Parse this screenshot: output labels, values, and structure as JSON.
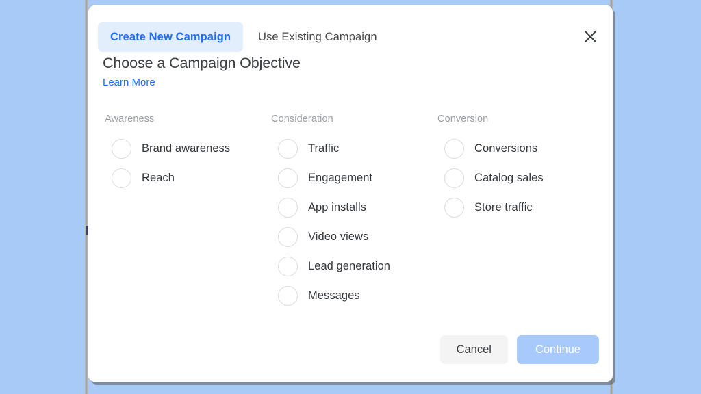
{
  "theme": {
    "backdrop_color": "#a7caf6",
    "modal_bg": "#ffffff",
    "accent_blue": "#1f6ffc",
    "active_tab_bg": "#e3eefd",
    "muted_text": "#9aa0a6",
    "body_text": "#35393d",
    "continue_bg": "#a7c9fb",
    "cancel_bg": "#f4f4f4",
    "radio_border": "#dadce0"
  },
  "modal": {
    "tabs": [
      {
        "label": "Create New Campaign",
        "active": true
      },
      {
        "label": "Use Existing Campaign",
        "active": false
      }
    ],
    "close_icon": "close-icon",
    "heading": "Choose a Campaign Objective",
    "learn_more": "Learn More",
    "columns": [
      {
        "title": "Awareness",
        "options": [
          {
            "label": "Brand awareness",
            "selected": false
          },
          {
            "label": "Reach",
            "selected": false
          }
        ]
      },
      {
        "title": "Consideration",
        "options": [
          {
            "label": "Traffic",
            "selected": false
          },
          {
            "label": "Engagement",
            "selected": false
          },
          {
            "label": "App installs",
            "selected": false
          },
          {
            "label": "Video views",
            "selected": false
          },
          {
            "label": "Lead generation",
            "selected": false
          },
          {
            "label": "Messages",
            "selected": false
          }
        ]
      },
      {
        "title": "Conversion",
        "options": [
          {
            "label": "Conversions",
            "selected": false
          },
          {
            "label": "Catalog sales",
            "selected": false
          },
          {
            "label": "Store traffic",
            "selected": false
          }
        ]
      }
    ],
    "footer": {
      "cancel_label": "Cancel",
      "continue_label": "Continue",
      "continue_disabled": true
    }
  }
}
